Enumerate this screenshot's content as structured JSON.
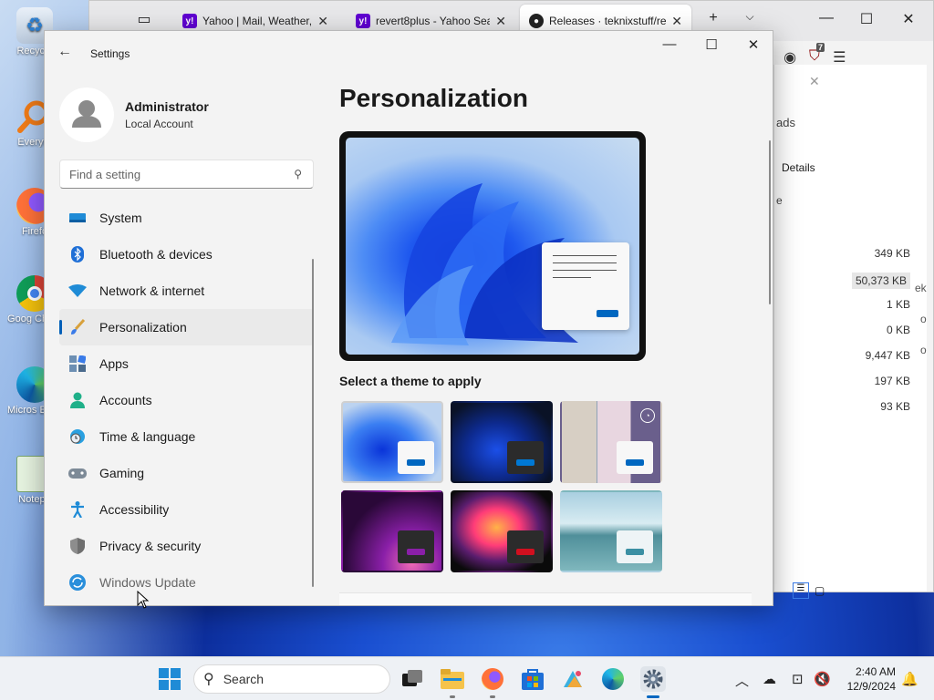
{
  "desktop": {
    "icons": [
      {
        "label": "Recycle",
        "icon": "recycle-bin-icon"
      },
      {
        "label": "Everyth",
        "icon": "everything-search-icon"
      },
      {
        "label": "Firefo",
        "icon": "firefox-icon"
      },
      {
        "label": "Goog Chron",
        "icon": "chrome-icon"
      },
      {
        "label": "Micros Edge",
        "icon": "edge-icon"
      },
      {
        "label": "Notepa",
        "icon": "notepad-icon"
      }
    ]
  },
  "browser": {
    "tabs": [
      {
        "label": "Yahoo | Mail, Weather, Se",
        "favicon": "yahoo-icon"
      },
      {
        "label": "revert8plus - Yahoo Searc",
        "favicon": "yahoo-icon"
      },
      {
        "label": "Releases · teknixstuff/reve",
        "favicon": "github-icon"
      }
    ],
    "new_tab": "+",
    "extension_badge": "7",
    "downloads_panel": {
      "heading": "ads",
      "details_button": "Details",
      "sizes": [
        "349 KB",
        "50,373 KB",
        "1 KB",
        "0 KB",
        "9,447 KB",
        "197 KB",
        "93 KB"
      ],
      "side_letters": [
        "ek",
        "o",
        "o"
      ],
      "misc": "e"
    }
  },
  "settings": {
    "app_title": "Settings",
    "profile": {
      "name": "Administrator",
      "account_type": "Local Account"
    },
    "search_placeholder": "Find a setting",
    "nav": [
      {
        "label": "System",
        "icon": "system-display-icon"
      },
      {
        "label": "Bluetooth & devices",
        "icon": "bluetooth-icon"
      },
      {
        "label": "Network & internet",
        "icon": "wifi-icon"
      },
      {
        "label": "Personalization",
        "icon": "paintbrush-icon",
        "selected": true
      },
      {
        "label": "Apps",
        "icon": "apps-icon"
      },
      {
        "label": "Accounts",
        "icon": "account-icon"
      },
      {
        "label": "Time & language",
        "icon": "clock-globe-icon"
      },
      {
        "label": "Gaming",
        "icon": "gamepad-icon"
      },
      {
        "label": "Accessibility",
        "icon": "accessibility-icon"
      },
      {
        "label": "Privacy & security",
        "icon": "shield-icon"
      },
      {
        "label": "Windows Update",
        "icon": "windows-update-icon"
      }
    ],
    "page_title": "Personalization",
    "theme_section_label": "Select a theme to apply",
    "themes": [
      {
        "name": "windows-light",
        "accent": "#0067c0"
      },
      {
        "name": "windows-dark",
        "accent": "#0078d4"
      },
      {
        "name": "glow-flowers",
        "accent": "#0067c0"
      },
      {
        "name": "captured-motion",
        "accent": "#8a1fa8"
      },
      {
        "name": "flow",
        "accent": "#d10f1f"
      },
      {
        "name": "sunrise-lake",
        "accent": "#3a8fa3"
      }
    ]
  },
  "taskbar": {
    "search_label": "Search",
    "apps": [
      "start-icon",
      "task-view-icon",
      "file-explorer-icon",
      "firefox-icon",
      "microsoft-store-icon",
      "photos-icon",
      "edge-icon",
      "settings-icon"
    ],
    "clock": {
      "time": "2:40 AM",
      "date": "12/9/2024"
    }
  },
  "colors": {
    "accent": "#005fb8",
    "taskbar_bg": "#eef1f5",
    "settings_bg": "#f3f3f3"
  }
}
